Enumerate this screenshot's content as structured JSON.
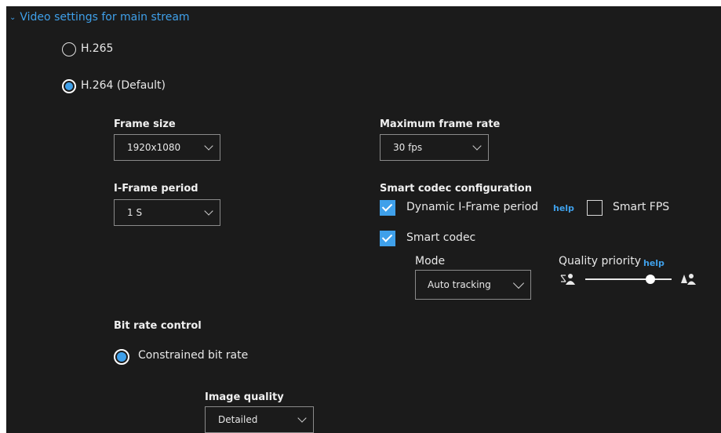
{
  "section": {
    "title": "Video settings for main stream"
  },
  "codec": {
    "h265_label": "H.265",
    "h264_label": "H.264 (Default)",
    "selected": "H.264 (Default)"
  },
  "frame_size": {
    "label": "Frame size",
    "value": "1920x1080"
  },
  "max_frame_rate": {
    "label": "Maximum frame rate",
    "value": "30 fps"
  },
  "iframe_period": {
    "label": "I-Frame period",
    "value": "1 S"
  },
  "smart_codec_config": {
    "label": "Smart codec configuration",
    "dynamic_iframe": {
      "label": "Dynamic I-Frame period",
      "checked": true,
      "help": "help"
    },
    "smart_fps": {
      "label": "Smart FPS",
      "checked": false
    },
    "smart_codec": {
      "label": "Smart codec",
      "checked": true
    },
    "mode": {
      "label": "Mode",
      "value": "Auto tracking"
    },
    "quality_priority": {
      "label": "Quality priority",
      "help": "help",
      "level": 0.75
    }
  },
  "bit_rate_control": {
    "label": "Bit rate control",
    "option_label": "Constrained bit rate",
    "selected": true
  },
  "image_quality": {
    "label": "Image quality",
    "value": "Detailed"
  },
  "colors": {
    "accent": "#3fa0ea",
    "background": "#1b1b1b",
    "text": "#e8e8e8"
  }
}
